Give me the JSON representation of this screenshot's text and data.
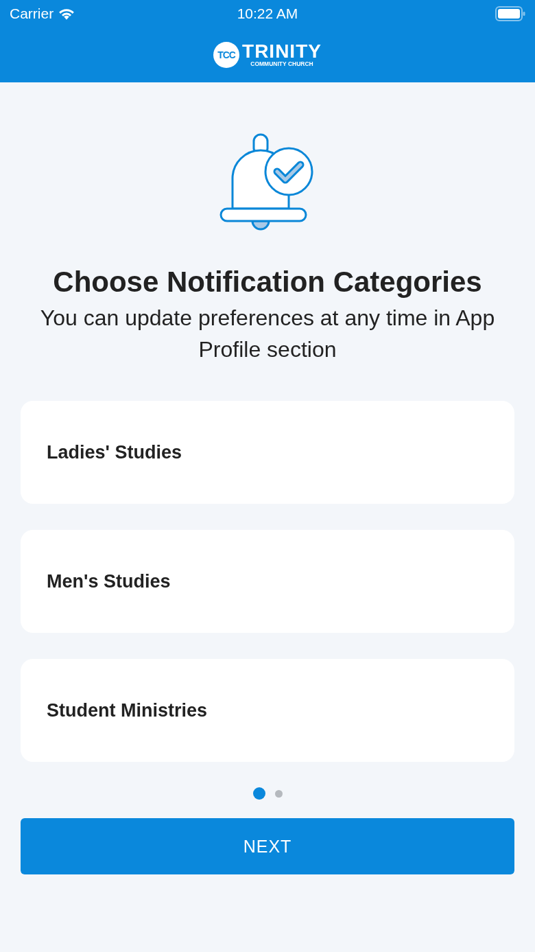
{
  "status_bar": {
    "carrier": "Carrier",
    "time": "10:22 AM"
  },
  "logo": {
    "badge": "TCC",
    "name": "TRINITY",
    "tagline": "COMMUNITY CHURCH"
  },
  "title": "Choose Notification Categories",
  "subtitle": "You can update preferences at any time in App Profile section",
  "categories": [
    {
      "label": "Ladies' Studies"
    },
    {
      "label": "Men's Studies"
    },
    {
      "label": "Student Ministries"
    }
  ],
  "pages": [
    {
      "selected": true
    },
    {
      "selected": false
    }
  ],
  "button": "NEXT"
}
